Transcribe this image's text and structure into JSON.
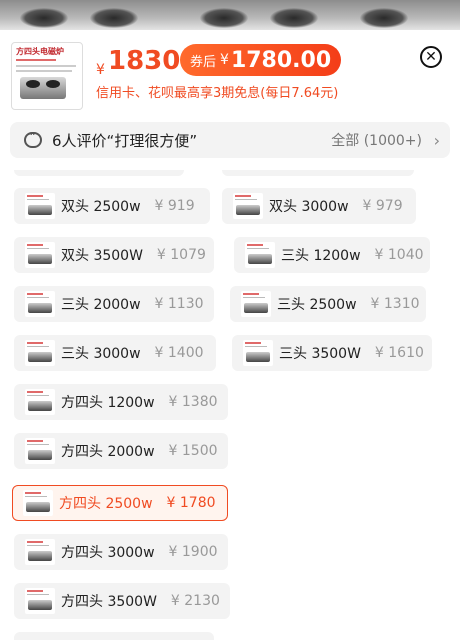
{
  "header": {
    "thumb_title": "方四头电磁炉",
    "price_yen": "¥",
    "price": "1830",
    "coupon_label": "券后",
    "coupon_yen": "¥",
    "coupon_price": "1780.00",
    "installment": "信用卡、花呗最高享3期免息(每日7.64元)",
    "close_icon": "close-icon"
  },
  "reviews": {
    "text": "6人评价“打理很方便”",
    "all_label": "全部 (1000+)",
    "chevron": "›"
  },
  "options": [
    {
      "name": "双头 2500w",
      "price": "¥ 919",
      "selected": false
    },
    {
      "name": "双头 3000w",
      "price": "¥ 979",
      "selected": false
    },
    {
      "name": "双头 3500W",
      "price": "¥ 1079",
      "selected": false
    },
    {
      "name": "三头 1200w",
      "price": "¥ 1040",
      "selected": false
    },
    {
      "name": "三头 2000w",
      "price": "¥ 1130",
      "selected": false
    },
    {
      "name": "三头 2500w",
      "price": "¥ 1310",
      "selected": false
    },
    {
      "name": "三头 3000w",
      "price": "¥ 1400",
      "selected": false
    },
    {
      "name": "三头 3500W",
      "price": "¥ 1610",
      "selected": false
    },
    {
      "name": "方四头 1200w",
      "price": "¥ 1380",
      "selected": false
    },
    {
      "name": "方四头 2000w",
      "price": "¥ 1500",
      "selected": false
    },
    {
      "name": "方四头 2500w",
      "price": "¥ 1780",
      "selected": true
    },
    {
      "name": "方四头 3000w",
      "price": "¥ 1900",
      "selected": false
    },
    {
      "name": "方四头 3500W",
      "price": "¥ 2130",
      "selected": false
    }
  ],
  "colors": {
    "accent": "#f04b22",
    "muted": "#999999",
    "chip_bg": "#f3f3f3"
  }
}
